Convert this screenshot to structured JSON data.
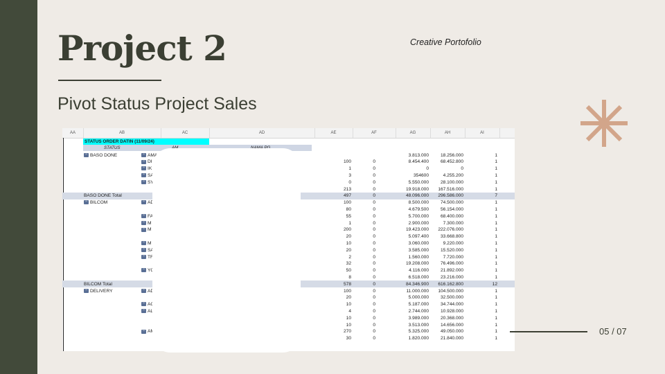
{
  "slide": {
    "title": "Project 2",
    "subtitle": "Pivot Status Project Sales",
    "tag": "Creative Portofolio",
    "page": "05 / 07",
    "accent_color": "#d2a58a",
    "sidebar_color": "#424a3a"
  },
  "sheet": {
    "columns": [
      "AA",
      "AB",
      "AC",
      "AD",
      "AE",
      "AF",
      "AG",
      "AH",
      "AI"
    ],
    "pivot_title": "STATUS ORDER DATIN (11/09/24)",
    "headers": {
      "status": "STATUS",
      "am": "AM",
      "nama": "NAMA PG"
    },
    "rows": [
      {
        "status": "BASO DONE",
        "am": "AMA",
        "ae": "",
        "af": "",
        "ag": "3.813.000",
        "ah": "18.256.000",
        "ai": "1"
      },
      {
        "status": "",
        "am": "DI",
        "ae": "100",
        "af": "0",
        "ag": "8.454.400",
        "ah": "68.452.800",
        "ai": "1"
      },
      {
        "status": "",
        "am": "IK",
        "ae": "1",
        "af": "0",
        "ag": "0",
        "ah": "0",
        "ai": "1"
      },
      {
        "status": "",
        "am": "SA",
        "ae": "3",
        "af": "0",
        "ag": "354600",
        "ah": "4.255.200",
        "ai": "1"
      },
      {
        "status": "",
        "am": "SY",
        "ae": "0",
        "af": "0",
        "ag": "5.550.000",
        "ah": "28.100.000",
        "ai": "1"
      },
      {
        "status": "",
        "am": "",
        "ae": "213",
        "af": "0",
        "ag": "19.918.000",
        "ah": "167.516.000",
        "ai": "1"
      },
      {
        "status": "BASO DONE Total",
        "am": "",
        "ae": "497",
        "af": "0",
        "ag": "48.096.000",
        "ah": "296.586.000",
        "ai": "7",
        "total": true
      },
      {
        "status": "BILCOM",
        "am": "AD",
        "ae": "100",
        "af": "0",
        "ag": "8.500.000",
        "ah": "74.500.000",
        "ai": "1"
      },
      {
        "status": "",
        "am": "",
        "ae": "80",
        "af": "0",
        "ag": "4.679.500",
        "ah": "56.154.000",
        "ai": "1"
      },
      {
        "status": "",
        "am": "FA",
        "ae": "55",
        "af": "0",
        "ag": "5.700.000",
        "ah": "68.400.000",
        "ai": "1"
      },
      {
        "status": "",
        "am": "M",
        "ae": "1",
        "af": "0",
        "ag": "2.900.000",
        "ah": "7.300.000",
        "ai": "1"
      },
      {
        "status": "",
        "am": "M",
        "ae": "200",
        "af": "0",
        "ag": "19.423.000",
        "ah": "222.076.000",
        "ai": "1"
      },
      {
        "status": "",
        "am": "",
        "ae": "20",
        "af": "0",
        "ag": "5.097.400",
        "ah": "33.668.800",
        "ai": "1"
      },
      {
        "status": "",
        "am": "M",
        "ae": "10",
        "af": "0",
        "ag": "3.060.000",
        "ah": "9.220.000",
        "ai": "1"
      },
      {
        "status": "",
        "am": "SA",
        "ae": "20",
        "af": "0",
        "ag": "3.585.000",
        "ah": "15.520.000",
        "ai": "1"
      },
      {
        "status": "",
        "am": "TF",
        "ae": "2",
        "af": "0",
        "ag": "1.560.000",
        "ah": "7.720.000",
        "ai": "1"
      },
      {
        "status": "",
        "am": "",
        "ae": "32",
        "af": "0",
        "ag": "19.208.000",
        "ah": "76.496.000",
        "ai": "1"
      },
      {
        "status": "",
        "am": "YO",
        "ae": "50",
        "af": "0",
        "ag": "4.116.000",
        "ah": "21.892.000",
        "ai": "1"
      },
      {
        "status": "",
        "am": "",
        "ae": "8",
        "af": "0",
        "ag": "6.518.000",
        "ah": "23.216.000",
        "ai": "1"
      },
      {
        "status": "BILCOM Total",
        "am": "",
        "ae": "578",
        "af": "0",
        "ag": "84.346.900",
        "ah": "616.162.800",
        "ai": "12",
        "total": true
      },
      {
        "status": "DELIVERY",
        "am": "AD",
        "ae": "100",
        "af": "0",
        "ag": "11.000.000",
        "ah": "104.500.000",
        "ai": "1"
      },
      {
        "status": "",
        "am": "",
        "ae": "20",
        "af": "0",
        "ag": "5.000.000",
        "ah": "32.500.000",
        "ai": "1"
      },
      {
        "status": "",
        "am": "AG",
        "ae": "10",
        "af": "0",
        "ag": "5.187.000",
        "ah": "34.744.000",
        "ai": "1"
      },
      {
        "status": "",
        "am": "AL",
        "ae": "4",
        "af": "0",
        "ag": "2.744.000",
        "ah": "10.928.000",
        "ai": "1"
      },
      {
        "status": "",
        "am": "",
        "ae": "10",
        "af": "0",
        "ag": "3.989.000",
        "ah": "20.368.000",
        "ai": "1"
      },
      {
        "status": "",
        "am": "",
        "ae": "10",
        "af": "0",
        "ag": "3.513.000",
        "ah": "14.656.000",
        "ai": "1"
      },
      {
        "status": "",
        "am": "AM",
        "ae": "270",
        "af": "0",
        "ag": "5.325.000",
        "ah": "49.050.000",
        "ai": "1"
      },
      {
        "status": "",
        "am": "",
        "ae": "30",
        "af": "0",
        "ag": "1.820.000",
        "ah": "21.840.000",
        "ai": "1"
      }
    ]
  }
}
